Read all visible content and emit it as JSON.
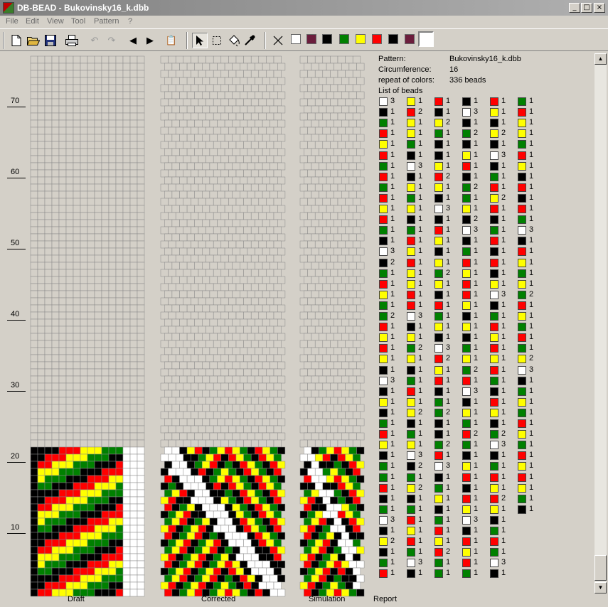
{
  "window": {
    "title": "DB-BEAD - Bukovinsky16_k.dbb",
    "controls": [
      "_",
      "□",
      "×"
    ]
  },
  "menu": [
    "File",
    "Edit",
    "View",
    "Tool",
    "Pattern",
    "?"
  ],
  "toolbar": {
    "tools": [
      "new-icon",
      "open-icon",
      "save-icon",
      "print-icon",
      "undo-icon",
      "redo-icon",
      "arrow-left-icon",
      "arrow-right-icon",
      "paste-icon",
      "pointer-icon",
      "select-rect-icon",
      "fill-icon",
      "eyedropper-icon"
    ],
    "colors": [
      "#ffffff",
      "#6b1d3c",
      "#000000",
      "#008000",
      "#ffff00",
      "#ff0000",
      "#000000",
      "#6b1d3c",
      "#000000",
      "#ffffff"
    ],
    "selected_color_index": 9
  },
  "ruler": [
    "70",
    "60",
    "50",
    "40",
    "30",
    "20",
    "10"
  ],
  "panels": {
    "draft": "Draft",
    "corrected": "Corrected",
    "simulation": "Simulation",
    "report": "Report"
  },
  "report": {
    "pattern_label": "Pattern:",
    "pattern_value": "Bukovinsky16_k.dbb",
    "circumference_label": "Circumference:",
    "circumference_value": "16",
    "repeat_label": "repeat of colors:",
    "repeat_value": "336 beads",
    "list_label": "List of beads",
    "columns": [
      [
        [
          "W",
          "3"
        ],
        [
          "K",
          "1"
        ],
        [
          "G",
          "1"
        ],
        [
          "R",
          "1"
        ],
        [
          "Y",
          "1"
        ],
        [
          "R",
          "1"
        ],
        [
          "G",
          "1"
        ],
        [
          "R",
          "1"
        ],
        [
          "G",
          "1"
        ],
        [
          "R",
          "1"
        ],
        [
          "Y",
          "1"
        ],
        [
          "R",
          "1"
        ],
        [
          "G",
          "1"
        ],
        [
          "K",
          "1"
        ],
        [
          "W",
          "3"
        ],
        [
          "K",
          "2"
        ],
        [
          "G",
          "1"
        ],
        [
          "R",
          "1"
        ],
        [
          "Y",
          "1"
        ],
        [
          "G",
          "1"
        ],
        [
          "G",
          "2"
        ],
        [
          "R",
          "1"
        ],
        [
          "Y",
          "1"
        ],
        [
          "R",
          "1"
        ],
        [
          "Y",
          "1"
        ],
        [
          "K",
          "1"
        ],
        [
          "W",
          "3"
        ],
        [
          "K",
          "1"
        ],
        [
          "Y",
          "1"
        ],
        [
          "K",
          "1"
        ],
        [
          "G",
          "1"
        ],
        [
          "R",
          "1"
        ],
        [
          "Y",
          "1"
        ],
        [
          "K",
          "1"
        ],
        [
          "G",
          "1"
        ],
        [
          "G",
          "1"
        ],
        [
          "R",
          "1"
        ],
        [
          "K",
          "1"
        ],
        [
          "G",
          "1"
        ],
        [
          "W",
          "3"
        ],
        [
          "K",
          "1"
        ],
        [
          "Y",
          "2"
        ],
        [
          "K",
          "1"
        ],
        [
          "G",
          "1"
        ],
        [
          "R",
          "1"
        ]
      ],
      [
        [
          "Y",
          "1"
        ],
        [
          "R",
          "2"
        ],
        [
          "Y",
          "1"
        ],
        [
          "Y",
          "1"
        ],
        [
          "G",
          "1"
        ],
        [
          "K",
          "1"
        ],
        [
          "W",
          "3"
        ],
        [
          "K",
          "1"
        ],
        [
          "Y",
          "1"
        ],
        [
          "G",
          "1"
        ],
        [
          "Y",
          "1"
        ],
        [
          "K",
          "1"
        ],
        [
          "G",
          "1"
        ],
        [
          "R",
          "1"
        ],
        [
          "Y",
          "1"
        ],
        [
          "R",
          "1"
        ],
        [
          "Y",
          "1"
        ],
        [
          "Y",
          "1"
        ],
        [
          "R",
          "1"
        ],
        [
          "R",
          "1"
        ],
        [
          "W",
          "3"
        ],
        [
          "K",
          "1"
        ],
        [
          "Y",
          "1"
        ],
        [
          "G",
          "2"
        ],
        [
          "Y",
          "1"
        ],
        [
          "K",
          "1"
        ],
        [
          "G",
          "1"
        ],
        [
          "R",
          "1"
        ],
        [
          "Y",
          "1"
        ],
        [
          "Y",
          "2"
        ],
        [
          "K",
          "1"
        ],
        [
          "G",
          "1"
        ],
        [
          "Y",
          "1"
        ],
        [
          "W",
          "3"
        ],
        [
          "K",
          "2"
        ],
        [
          "G",
          "1"
        ],
        [
          "Y",
          "2"
        ],
        [
          "K",
          "1"
        ],
        [
          "G",
          "1"
        ],
        [
          "R",
          "1"
        ],
        [
          "Y",
          "1"
        ],
        [
          "R",
          "1"
        ],
        [
          "G",
          "1"
        ],
        [
          "W",
          "3"
        ],
        [
          "K",
          "1"
        ]
      ],
      [
        [
          "R",
          "1"
        ],
        [
          "K",
          "1"
        ],
        [
          "Y",
          "2"
        ],
        [
          "G",
          "1"
        ],
        [
          "K",
          "1"
        ],
        [
          "K",
          "1"
        ],
        [
          "Y",
          "1"
        ],
        [
          "R",
          "2"
        ],
        [
          "Y",
          "1"
        ],
        [
          "K",
          "1"
        ],
        [
          "W",
          "3"
        ],
        [
          "K",
          "1"
        ],
        [
          "R",
          "1"
        ],
        [
          "Y",
          "1"
        ],
        [
          "K",
          "1"
        ],
        [
          "Y",
          "1"
        ],
        [
          "G",
          "2"
        ],
        [
          "Y",
          "1"
        ],
        [
          "K",
          "1"
        ],
        [
          "R",
          "1"
        ],
        [
          "G",
          "1"
        ],
        [
          "Y",
          "1"
        ],
        [
          "K",
          "1"
        ],
        [
          "W",
          "3"
        ],
        [
          "R",
          "2"
        ],
        [
          "Y",
          "1"
        ],
        [
          "R",
          "1"
        ],
        [
          "K",
          "1"
        ],
        [
          "G",
          "1"
        ],
        [
          "G",
          "2"
        ],
        [
          "K",
          "1"
        ],
        [
          "K",
          "1"
        ],
        [
          "G",
          "2"
        ],
        [
          "R",
          "1"
        ],
        [
          "W",
          "3"
        ],
        [
          "K",
          "1"
        ],
        [
          "G",
          "1"
        ],
        [
          "Y",
          "1"
        ],
        [
          "K",
          "1"
        ],
        [
          "G",
          "1"
        ],
        [
          "R",
          "1"
        ],
        [
          "Y",
          "1"
        ],
        [
          "R",
          "2"
        ],
        [
          "G",
          "1"
        ],
        [
          "G",
          "1"
        ]
      ],
      [
        [
          "K",
          "1"
        ],
        [
          "W",
          "3"
        ],
        [
          "K",
          "1"
        ],
        [
          "G",
          "2"
        ],
        [
          "K",
          "1"
        ],
        [
          "Y",
          "1"
        ],
        [
          "R",
          "1"
        ],
        [
          "K",
          "1"
        ],
        [
          "G",
          "2"
        ],
        [
          "G",
          "1"
        ],
        [
          "Y",
          "1"
        ],
        [
          "K",
          "2"
        ],
        [
          "W",
          "3"
        ],
        [
          "K",
          "1"
        ],
        [
          "G",
          "1"
        ],
        [
          "R",
          "1"
        ],
        [
          "Y",
          "1"
        ],
        [
          "R",
          "1"
        ],
        [
          "R",
          "1"
        ],
        [
          "Y",
          "1"
        ],
        [
          "K",
          "1"
        ],
        [
          "Y",
          "1"
        ],
        [
          "K",
          "1"
        ],
        [
          "G",
          "1"
        ],
        [
          "Y",
          "1"
        ],
        [
          "G",
          "2"
        ],
        [
          "R",
          "1"
        ],
        [
          "W",
          "3"
        ],
        [
          "K",
          "1"
        ],
        [
          "Y",
          "1"
        ],
        [
          "G",
          "1"
        ],
        [
          "R",
          "2"
        ],
        [
          "G",
          "1"
        ],
        [
          "K",
          "1"
        ],
        [
          "Y",
          "1"
        ],
        [
          "R",
          "1"
        ],
        [
          "K",
          "1"
        ],
        [
          "R",
          "1"
        ],
        [
          "Y",
          "1"
        ],
        [
          "W",
          "3"
        ],
        [
          "K",
          "1"
        ],
        [
          "R",
          "1"
        ],
        [
          "Y",
          "1"
        ],
        [
          "R",
          "1"
        ],
        [
          "G",
          "1"
        ]
      ],
      [
        [
          "R",
          "1"
        ],
        [
          "Y",
          "1"
        ],
        [
          "K",
          "1"
        ],
        [
          "Y",
          "2"
        ],
        [
          "K",
          "1"
        ],
        [
          "W",
          "3"
        ],
        [
          "K",
          "1"
        ],
        [
          "G",
          "1"
        ],
        [
          "R",
          "1"
        ],
        [
          "Y",
          "2"
        ],
        [
          "R",
          "1"
        ],
        [
          "K",
          "1"
        ],
        [
          "G",
          "1"
        ],
        [
          "R",
          "1"
        ],
        [
          "K",
          "1"
        ],
        [
          "R",
          "1"
        ],
        [
          "K",
          "1"
        ],
        [
          "Y",
          "1"
        ],
        [
          "W",
          "3"
        ],
        [
          "K",
          "1"
        ],
        [
          "G",
          "1"
        ],
        [
          "R",
          "1"
        ],
        [
          "Y",
          "1"
        ],
        [
          "R",
          "1"
        ],
        [
          "Y",
          "1"
        ],
        [
          "R",
          "1"
        ],
        [
          "G",
          "1"
        ],
        [
          "K",
          "1"
        ],
        [
          "R",
          "1"
        ],
        [
          "Y",
          "1"
        ],
        [
          "K",
          "1"
        ],
        [
          "G",
          "2"
        ],
        [
          "W",
          "3"
        ],
        [
          "K",
          "1"
        ],
        [
          "G",
          "1"
        ],
        [
          "R",
          "1"
        ],
        [
          "Y",
          "1"
        ],
        [
          "R",
          "2"
        ],
        [
          "Y",
          "1"
        ],
        [
          "K",
          "1"
        ],
        [
          "G",
          "1"
        ],
        [
          "R",
          "1"
        ],
        [
          "G",
          "1"
        ],
        [
          "W",
          "3"
        ],
        [
          "K",
          "1"
        ]
      ],
      [
        [
          "G",
          "1"
        ],
        [
          "R",
          "1"
        ],
        [
          "Y",
          "1"
        ],
        [
          "Y",
          "1"
        ],
        [
          "G",
          "1"
        ],
        [
          "R",
          "1"
        ],
        [
          "Y",
          "1"
        ],
        [
          "K",
          "1"
        ],
        [
          "R",
          "1"
        ],
        [
          "K",
          "1"
        ],
        [
          "R",
          "1"
        ],
        [
          "G",
          "1"
        ],
        [
          "W",
          "3"
        ],
        [
          "K",
          "1"
        ],
        [
          "R",
          "1"
        ],
        [
          "Y",
          "1"
        ],
        [
          "G",
          "1"
        ],
        [
          "Y",
          "1"
        ],
        [
          "G",
          "2"
        ],
        [
          "R",
          "1"
        ],
        [
          "Y",
          "1"
        ],
        [
          "G",
          "1"
        ],
        [
          "R",
          "1"
        ],
        [
          "G",
          "1"
        ],
        [
          "Y",
          "2"
        ],
        [
          "W",
          "3"
        ],
        [
          "K",
          "1"
        ],
        [
          "G",
          "1"
        ],
        [
          "Y",
          "1"
        ],
        [
          "G",
          "1"
        ],
        [
          "R",
          "1"
        ],
        [
          "Y",
          "1"
        ],
        [
          "G",
          "1"
        ],
        [
          "R",
          "1"
        ],
        [
          "Y",
          "1"
        ],
        [
          "R",
          "1"
        ],
        [
          "Y",
          "1"
        ],
        [
          "G",
          "1"
        ],
        [
          "K",
          "1"
        ]
      ]
    ]
  }
}
